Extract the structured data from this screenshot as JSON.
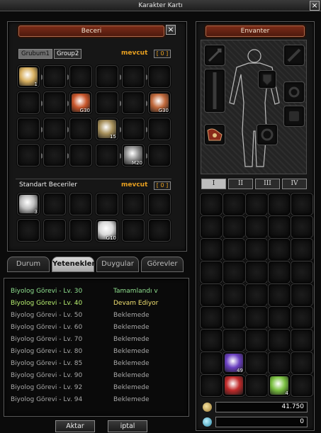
{
  "window": {
    "title": "Karakter Kartı"
  },
  "skills_panel": {
    "title": "Beceri",
    "group_tabs": [
      "Grubum1",
      "Group2"
    ],
    "mevcut_label": "mevcut",
    "points": "0",
    "group_skills": [
      {
        "label": "1",
        "icon": "star-burst-icon",
        "color": "#d8b060"
      },
      {
        "label": "G30",
        "icon": "rising-chevrons-icon",
        "color": "#c8552a"
      },
      {
        "label": "G30",
        "icon": "sun-aura-icon",
        "color": "#c0683a"
      },
      {
        "label": "15",
        "icon": "swirl-icon",
        "color": "#a68f5a"
      },
      {
        "label": "M20",
        "icon": "beast-icon",
        "color": "#8c8c8c"
      }
    ],
    "standard_label": "Standart Beceriler",
    "standard_mevcut_label": "mevcut",
    "standard_points": "0",
    "standard_skills": [
      {
        "label": "3",
        "icon": "slash-icon",
        "color": "#bdbdbd"
      },
      {
        "label": "G10",
        "icon": "fist-icon",
        "color": "#d8d8d8"
      }
    ]
  },
  "bottom_tabs": [
    "Durum",
    "Yetenekler",
    "Duygular",
    "Görevler"
  ],
  "active_bottom_tab": "Yetenekler",
  "quests": [
    {
      "name": "Biyolog Görevi - Lv. 30",
      "status": "Tamamlandı v",
      "name_color": "#8fe08f",
      "status_color": "#8fe08f"
    },
    {
      "name": "Biyolog Görevi - Lv. 40",
      "status": "Devam Ediyor",
      "name_color": "#b8f070",
      "status_color": "#f0e070"
    },
    {
      "name": "Biyolog Görevi - Lv. 50",
      "status": "Beklemede",
      "name_color": "#a8a8a8",
      "status_color": "#a8a8a8"
    },
    {
      "name": "Biyolog Görevi - Lv. 60",
      "status": "Beklemede",
      "name_color": "#a8a8a8",
      "status_color": "#a8a8a8"
    },
    {
      "name": "Biyolog Görevi - Lv. 70",
      "status": "Beklemede",
      "name_color": "#a8a8a8",
      "status_color": "#a8a8a8"
    },
    {
      "name": "Biyolog Görevi - Lv. 80",
      "status": "Beklemede",
      "name_color": "#a8a8a8",
      "status_color": "#a8a8a8"
    },
    {
      "name": "Biyolog Görevi - Lv. 85",
      "status": "Beklemede",
      "name_color": "#a8a8a8",
      "status_color": "#a8a8a8"
    },
    {
      "name": "Biyolog Görevi - Lv. 90",
      "status": "Beklemede",
      "name_color": "#a8a8a8",
      "status_color": "#a8a8a8"
    },
    {
      "name": "Biyolog Görevi - Lv. 92",
      "status": "Beklemede",
      "name_color": "#a8a8a8",
      "status_color": "#a8a8a8"
    },
    {
      "name": "Biyolog Görevi - Lv. 94",
      "status": "Beklemede",
      "name_color": "#a8a8a8",
      "status_color": "#a8a8a8"
    }
  ],
  "buttons": {
    "accept": "Aktar",
    "cancel": "iptal"
  },
  "inventory": {
    "title": "Envanter",
    "pages": [
      "I",
      "II",
      "III",
      "IV"
    ],
    "active_page": "I",
    "items": [
      {
        "label": "49",
        "icon": "purple-potion-icon",
        "color": "#6a3fc0"
      },
      {
        "label": "",
        "icon": "red-potion-icon",
        "color": "#c02a2a"
      },
      {
        "label": "4",
        "icon": "green-feather-icon",
        "color": "#7ac040"
      }
    ],
    "yang": "41.750",
    "gems": "0"
  }
}
